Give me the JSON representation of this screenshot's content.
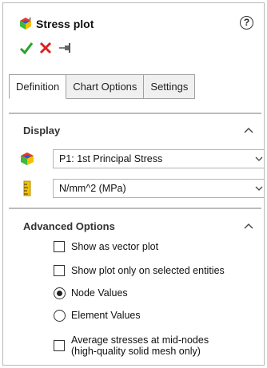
{
  "header": {
    "title": "Stress plot",
    "help_label": "?",
    "icon": "stress-plot-icon",
    "actions": [
      {
        "name": "ok-button",
        "icon": "checkmark-icon",
        "color": "#27a327"
      },
      {
        "name": "cancel-button",
        "icon": "close-icon",
        "color": "#e02020"
      },
      {
        "name": "pin-button",
        "icon": "pushpin-icon",
        "color": "#555555"
      }
    ]
  },
  "tabs": [
    {
      "label": "Definition",
      "active": true
    },
    {
      "label": "Chart Options",
      "active": false
    },
    {
      "label": "Settings",
      "active": false
    }
  ],
  "display": {
    "title": "Display",
    "component_select": {
      "value": "P1: 1st Principal Stress",
      "icon": "stress-component-icon"
    },
    "units_select": {
      "value": "N/mm^2 (MPa)",
      "icon": "ruler-icon"
    }
  },
  "advanced": {
    "title": "Advanced Options",
    "options": {
      "vector_plot": {
        "label": "Show as vector plot",
        "checked": false
      },
      "selected_only": {
        "label": "Show plot only on selected entities",
        "checked": false
      },
      "node_values": {
        "label": "Node Values",
        "selected": true
      },
      "element_values": {
        "label": "Element Values",
        "selected": false
      },
      "average_line1": "Average stresses at mid-nodes",
      "average_line2": "(high-quality solid mesh only)"
    }
  },
  "colors": {
    "accent_green": "#27a327",
    "cancel_red": "#e02020"
  }
}
